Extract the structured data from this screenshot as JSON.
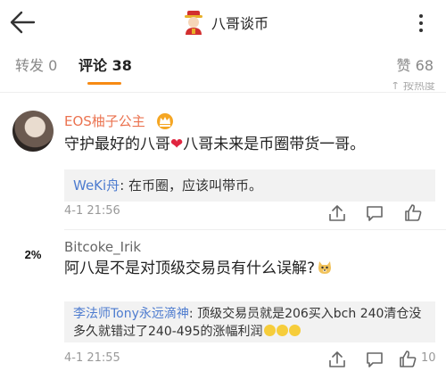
{
  "header": {
    "title": "八哥谈币",
    "back_icon": "arrow-left-icon",
    "more_icon": "more-vertical-icon"
  },
  "tabs": {
    "repost": "转发 0",
    "comment": "评论 38",
    "like": "赞 68",
    "accent": "#f78a14"
  },
  "sort_hint": "↑ 按热度",
  "comments": [
    {
      "name": "EOS柚子公主",
      "text_before": "守护最好的八哥",
      "heart": "❤",
      "text_after": "八哥未来是币圈带货一哥。",
      "reply_name": "WeKi舟",
      "reply_text": ": 在币圈，应该叫带币。",
      "date": "4-1 21:56",
      "likes": ""
    },
    {
      "name": "Bitcoke_Irik",
      "avatar_text": "2%",
      "text": "阿八是不是对顶级交易员有什么误解?",
      "reply_name": "李法师Tony永远滴神",
      "reply_text": ": 顶级交易员就是206买入bch 240清仓没多久就错过了240-495的涨幅利润",
      "date": "4-1 21:55",
      "likes": "10"
    }
  ]
}
